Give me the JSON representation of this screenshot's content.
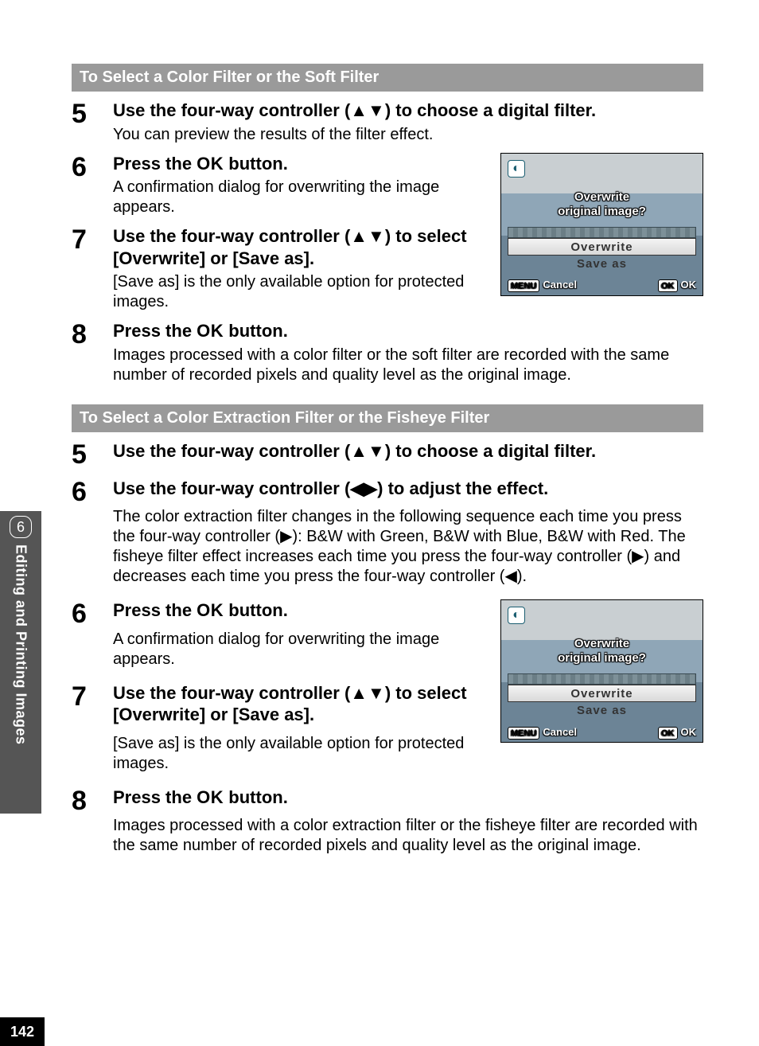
{
  "chapter": {
    "number": "6",
    "label": "Editing and Printing Images"
  },
  "page_number": "142",
  "section_a": {
    "header": "To Select a Color Filter or the Soft Filter",
    "s5": {
      "num": "5",
      "title_pre": "Use the four-way controller (",
      "title_arrows": "▲▼",
      "title_post": ") to choose a digital filter.",
      "desc": "You can preview the results of the filter effect."
    },
    "s6": {
      "num": "6",
      "title_pre": "Press the ",
      "title_ok": "OK",
      "title_post": " button.",
      "desc": "A confirmation dialog for overwriting the image appears."
    },
    "s7": {
      "num": "7",
      "title_pre": "Use the four-way controller (",
      "title_arrows": "▲▼",
      "title_post": ") to select [Overwrite] or [Save as].",
      "desc": "[Save as] is the only available option for protected images."
    },
    "s8": {
      "num": "8",
      "title_pre": "Press the ",
      "title_ok": "OK",
      "title_post": " button.",
      "desc": "Images processed with a color filter or the soft filter are recorded with the same number of recorded pixels and quality level as the original image."
    }
  },
  "section_b": {
    "header": "To Select a Color Extraction Filter or the Fisheye Filter",
    "s5": {
      "num": "5",
      "title_pre": "Use the four-way controller (",
      "title_arrows": "▲▼",
      "title_post": ") to choose a digital filter."
    },
    "s6a": {
      "num": "6",
      "title_pre": "Use the four-way controller (",
      "title_arrows": "◀▶",
      "title_post": ") to adjust the effect.",
      "desc": "The color extraction filter changes in the following sequence each time you press the four-way controller (▶): B&W with Green, B&W with Blue, B&W with Red. The fisheye filter effect increases each time you press the four-way controller (▶) and decreases each time you press the four-way controller (◀)."
    },
    "s6b": {
      "num": "6",
      "title_pre": "Press the ",
      "title_ok": "OK",
      "title_post": " button.",
      "desc": "A confirmation dialog for overwriting the image appears."
    },
    "s7": {
      "num": "7",
      "title_pre": "Use the four-way controller (",
      "title_arrows": "▲▼",
      "title_post": ") to select [Overwrite] or [Save as].",
      "desc": "[Save as] is the only available option for protected images."
    },
    "s8": {
      "num": "8",
      "title_pre": "Press the ",
      "title_ok": "OK",
      "title_post": " button.",
      "desc": "Images processed with a color extraction filter or the fisheye filter are recorded with the same number of recorded pixels and quality level as the original image."
    }
  },
  "camera_dialog": {
    "icon_glyph": "◐",
    "prompt_line1": "Overwrite",
    "prompt_line2": "original image?",
    "option_overwrite": "Overwrite",
    "option_saveas": "Save as",
    "menu_btn": "MENU",
    "cancel": "Cancel",
    "ok_btn": "OK",
    "ok_text": "OK"
  }
}
